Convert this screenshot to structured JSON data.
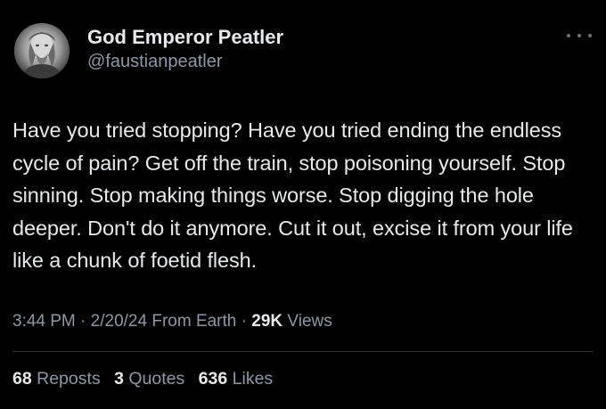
{
  "tweet": {
    "author": {
      "display_name": "God Emperor Peatler",
      "handle": "@faustianpeatler",
      "avatar_icon": "avatar-portrait"
    },
    "more_icon": "more-horizontal-icon",
    "text": "Have you tried stopping? Have you tried ending the endless cycle of pain? Get off the train, stop poisoning yourself. Stop sinning. Stop making things worse. Stop digging the hole deeper. Don't do it anymore. Cut it out, excise it from your life like a chunk of foetid flesh.",
    "meta": {
      "time": "3:44 PM",
      "sep1": " · ",
      "date": "2/20/24",
      "source": " From Earth",
      "sep2": " · ",
      "views_count": "29K",
      "views_label": " Views"
    },
    "stats": {
      "reposts_count": "68",
      "reposts_label": "Reposts",
      "quotes_count": "3",
      "quotes_label": "Quotes",
      "likes_count": "636",
      "likes_label": "Likes"
    }
  },
  "colors": {
    "background": "#000000",
    "primary_text": "#e7e9ea",
    "secondary_text": "#8b98a5",
    "divider": "#2f3336"
  }
}
